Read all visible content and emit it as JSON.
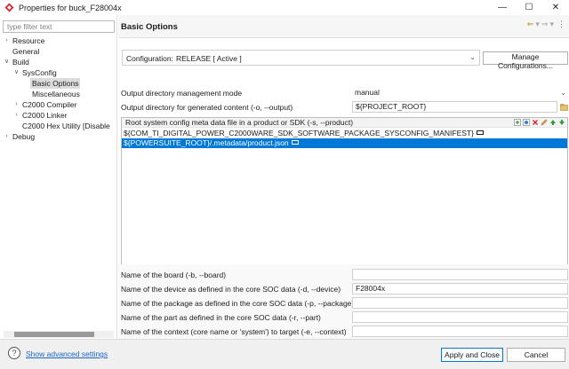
{
  "window": {
    "title": "Properties for buck_F28004x",
    "controls": [
      "minimize",
      "maximize",
      "close"
    ]
  },
  "sidebar": {
    "filter_placeholder": "type filter text",
    "items": [
      {
        "label": "Resource",
        "depth": 0,
        "expand": "collapsed",
        "selected": false
      },
      {
        "label": "General",
        "depth": 0,
        "expand": "none",
        "selected": false
      },
      {
        "label": "Build",
        "depth": 0,
        "expand": "expanded",
        "selected": false
      },
      {
        "label": "SysConfig",
        "depth": 1,
        "expand": "expanded",
        "selected": false
      },
      {
        "label": "Basic Options",
        "depth": 2,
        "expand": "none",
        "selected": true
      },
      {
        "label": "Miscellaneous",
        "depth": 2,
        "expand": "none",
        "selected": false
      },
      {
        "label": "C2000 Compiler",
        "depth": 1,
        "expand": "collapsed",
        "selected": false
      },
      {
        "label": "C2000 Linker",
        "depth": 1,
        "expand": "collapsed",
        "selected": false
      },
      {
        "label": "C2000 Hex Utility  [Disable",
        "depth": 1,
        "expand": "none",
        "selected": false
      },
      {
        "label": "Debug",
        "depth": 0,
        "expand": "collapsed",
        "selected": false
      }
    ]
  },
  "page": {
    "title": "Basic Options"
  },
  "configuration": {
    "label": "Configuration:",
    "value": "RELEASE  [ Active ]",
    "manage_label": "Manage Configurations..."
  },
  "output_mode": {
    "label": "Output directory management mode",
    "value": "manual"
  },
  "output_dir": {
    "label": "Output directory for generated content (-o, --output)",
    "value": "${PROJECT_ROOT}"
  },
  "product_list": {
    "header": "Root system config meta data file in a product or SDK (-s, --product)",
    "rows": [
      {
        "text": "${COM_TI_DIGITAL_POWER_C2000WARE_SDK_SOFTWARE_PACKAGE_SYSCONFIG_MANIFEST}",
        "selected": false
      },
      {
        "text": "${POWERSUITE_ROOT}/.metadata/product.json",
        "selected": true
      }
    ],
    "tools": [
      "add-icon",
      "add-workspace-icon",
      "delete-icon",
      "edit-icon",
      "move-up-icon",
      "move-down-icon"
    ]
  },
  "fields": [
    {
      "label": "Name of the board (-b, --board)",
      "value": ""
    },
    {
      "label": "Name of the device as defined in the core SOC data (-d, --device)",
      "value": "F28004x"
    },
    {
      "label": "Name of the package as defined in the core SOC data (-p, --package)",
      "value": ""
    },
    {
      "label": "Name of the part as defined in the core SOC data (-r, --part)",
      "value": ""
    },
    {
      "label": "Name of the context (core name or 'system') to target (-e, --context)",
      "value": ""
    }
  ],
  "footer": {
    "advanced_link": "Show advanced settings",
    "apply_close_label": "Apply and Close",
    "cancel_label": "Cancel"
  },
  "colors": {
    "selection": "#0078d7",
    "link": "#1a64c8",
    "nav_arrow": "#c08a1a"
  }
}
